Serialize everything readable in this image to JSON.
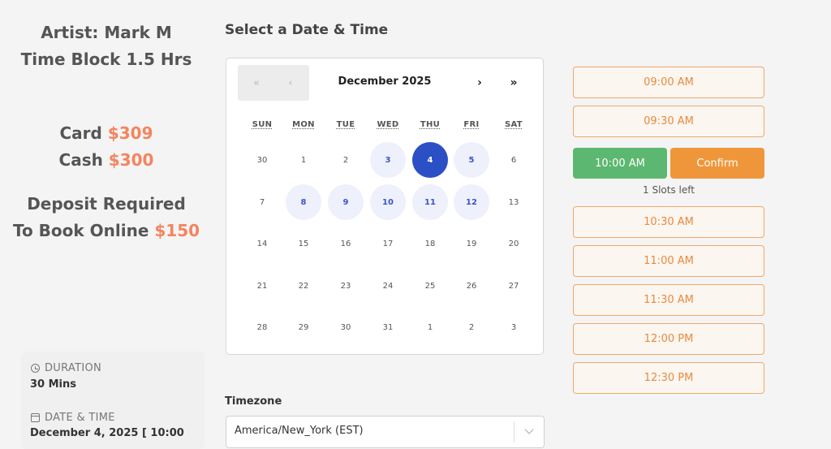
{
  "promo": {
    "artist": "Artist: Mark M",
    "time_block": "Time Block 1.5 Hrs",
    "card_label": "Card ",
    "card_price": "$309",
    "cash_label": "Cash ",
    "cash_price": "$300",
    "deposit_line1": "Deposit Required",
    "deposit_line2": "To Book Online ",
    "deposit_price": "$150",
    "accent_color": "#f4845f"
  },
  "summary": {
    "duration_label": "DURATION",
    "duration_value": "30 Mins",
    "datetime_label": "DATE & TIME",
    "datetime_value": "December 4, 2025 [ 10:00",
    "icons": [
      "clock-icon",
      "calendar-icon"
    ]
  },
  "booking": {
    "title": "Select a Date & Time",
    "timezone_label": "Timezone",
    "timezone_value": "America/New_York (EST)"
  },
  "calendar": {
    "month": "December 2025",
    "prev_year": "«",
    "prev_month": "‹",
    "next_month": "›",
    "next_year": "»",
    "weekdays": [
      "SUN",
      "MON",
      "TUE",
      "WED",
      "THU",
      "FRI",
      "SAT"
    ],
    "weeks": [
      [
        "30",
        "1",
        "2",
        "3",
        "4",
        "5",
        "6"
      ],
      [
        "7",
        "8",
        "9",
        "10",
        "11",
        "12",
        "13"
      ],
      [
        "14",
        "15",
        "16",
        "17",
        "18",
        "19",
        "20"
      ],
      [
        "21",
        "22",
        "23",
        "24",
        "25",
        "26",
        "27"
      ],
      [
        "28",
        "29",
        "30",
        "31",
        "1",
        "2",
        "3"
      ]
    ],
    "available": [
      "0-3",
      "0-5",
      "1-1",
      "1-2",
      "1-3",
      "1-4",
      "1-5"
    ],
    "selected": "0-4",
    "colors": {
      "selected": "#2b4fc5",
      "available_bg": "#eef0fc",
      "available_text": "#3b55c8"
    }
  },
  "slots": {
    "before": [
      "09:00 AM",
      "09:30 AM"
    ],
    "selected": "10:00 AM",
    "confirm": "Confirm",
    "slots_left": "1 Slots left",
    "after": [
      "10:30 AM",
      "11:00 AM",
      "11:30 AM",
      "12:00 PM",
      "12:30 PM"
    ],
    "colors": {
      "slot": "#e98a3e",
      "selected": "#5cb870",
      "confirm": "#f0963a"
    }
  }
}
